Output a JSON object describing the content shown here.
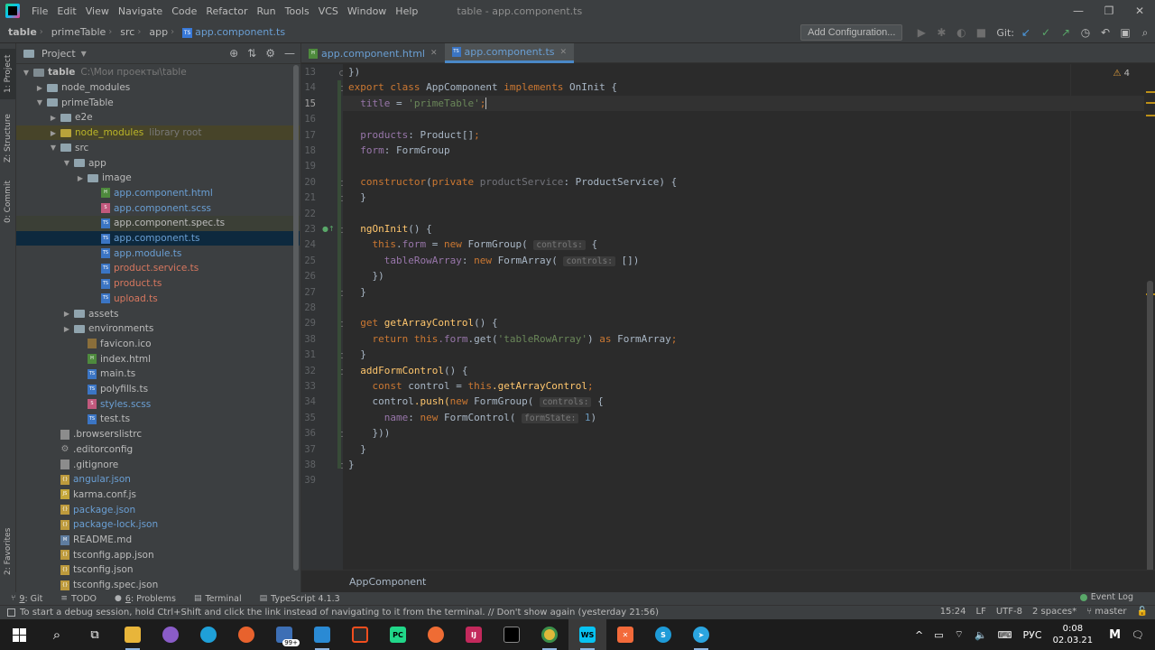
{
  "menubar": {
    "items": [
      "File",
      "Edit",
      "View",
      "Navigate",
      "Code",
      "Refactor",
      "Run",
      "Tools",
      "VCS",
      "Window",
      "Help"
    ],
    "window_title": "table - app.component.ts"
  },
  "navbar": {
    "crumbs": [
      "table",
      "primeTable",
      "src",
      "app",
      "app.component.ts"
    ],
    "add_config": "Add Configuration...",
    "git_label": "Git:"
  },
  "left_strip": {
    "project_tab": "1: Project",
    "structure_tab": "Z: Structure",
    "commit_tab": "0: Commit",
    "favorites_tab": "2: Favorites"
  },
  "project": {
    "header": "Project",
    "tree": [
      {
        "name": "table",
        "extra": "C:\\Мои проекты\\table",
        "depth": 0,
        "arrow": "down",
        "icon": "folder-dark",
        "style": "bold"
      },
      {
        "name": "node_modules",
        "depth": 1,
        "arrow": "right",
        "icon": "folder"
      },
      {
        "name": "primeTable",
        "depth": 1,
        "arrow": "down",
        "icon": "folder"
      },
      {
        "name": "e2e",
        "depth": 2,
        "arrow": "right",
        "icon": "folder"
      },
      {
        "name": "node_modules",
        "extra": "library root",
        "depth": 2,
        "arrow": "right",
        "icon": "folder-yellow",
        "style": "yellow",
        "row": "lib"
      },
      {
        "name": "src",
        "depth": 2,
        "arrow": "down",
        "icon": "folder"
      },
      {
        "name": "app",
        "depth": 3,
        "arrow": "down",
        "icon": "folder"
      },
      {
        "name": "image",
        "depth": 4,
        "arrow": "right",
        "icon": "folder"
      },
      {
        "name": "app.component.html",
        "depth": 5,
        "icon": "html",
        "style": "blue"
      },
      {
        "name": "app.component.scss",
        "depth": 5,
        "icon": "scss",
        "style": "blue"
      },
      {
        "name": "app.component.spec.ts",
        "depth": 5,
        "icon": "ts",
        "style": "white",
        "row": "hl"
      },
      {
        "name": "app.component.ts",
        "depth": 5,
        "icon": "ts",
        "style": "blue",
        "row": "sel"
      },
      {
        "name": "app.module.ts",
        "depth": 5,
        "icon": "ts",
        "style": "blue"
      },
      {
        "name": "product.service.ts",
        "depth": 5,
        "icon": "ts",
        "style": "red"
      },
      {
        "name": "product.ts",
        "depth": 5,
        "icon": "ts",
        "style": "red"
      },
      {
        "name": "upload.ts",
        "depth": 5,
        "icon": "ts",
        "style": "red"
      },
      {
        "name": "assets",
        "depth": 3,
        "arrow": "right",
        "icon": "folder"
      },
      {
        "name": "environments",
        "depth": 3,
        "arrow": "right",
        "icon": "folder"
      },
      {
        "name": "favicon.ico",
        "depth": 4,
        "icon": "ico",
        "style": "white"
      },
      {
        "name": "index.html",
        "depth": 4,
        "icon": "html",
        "style": "white"
      },
      {
        "name": "main.ts",
        "depth": 4,
        "icon": "ts",
        "style": "white"
      },
      {
        "name": "polyfills.ts",
        "depth": 4,
        "icon": "ts",
        "style": "white"
      },
      {
        "name": "styles.scss",
        "depth": 4,
        "icon": "scss",
        "style": "blue"
      },
      {
        "name": "test.ts",
        "depth": 4,
        "icon": "ts",
        "style": "white"
      },
      {
        "name": ".browserslistrc",
        "depth": 2,
        "icon": "txt",
        "style": "white"
      },
      {
        "name": ".editorconfig",
        "depth": 2,
        "icon": "gear",
        "style": "white"
      },
      {
        "name": ".gitignore",
        "depth": 2,
        "icon": "txt",
        "style": "white"
      },
      {
        "name": "angular.json",
        "depth": 2,
        "icon": "json",
        "style": "blue"
      },
      {
        "name": "karma.conf.js",
        "depth": 2,
        "icon": "js",
        "style": "white"
      },
      {
        "name": "package.json",
        "depth": 2,
        "icon": "json",
        "style": "blue"
      },
      {
        "name": "package-lock.json",
        "depth": 2,
        "icon": "json",
        "style": "blue"
      },
      {
        "name": "README.md",
        "depth": 2,
        "icon": "md",
        "style": "white"
      },
      {
        "name": "tsconfig.app.json",
        "depth": 2,
        "icon": "json",
        "style": "white"
      },
      {
        "name": "tsconfig.json",
        "depth": 2,
        "icon": "json",
        "style": "white"
      },
      {
        "name": "tsconfig.spec.json",
        "depth": 2,
        "icon": "json",
        "style": "white"
      }
    ]
  },
  "tabs": [
    {
      "label": "app.component.html",
      "icon": "html",
      "active": false
    },
    {
      "label": "app.component.ts",
      "icon": "ts",
      "active": true
    }
  ],
  "editor": {
    "line_numbers": [
      "13",
      "14",
      "15",
      "16",
      "17",
      "18",
      "19",
      "20",
      "21",
      "22",
      "23",
      "24",
      "25",
      "26",
      "27",
      "28",
      "29",
      "38",
      "31",
      "32",
      "33",
      "34",
      "35",
      "36",
      "37",
      "38",
      "39"
    ],
    "current_line": "15",
    "warnings": "4",
    "hints": {
      "controls": "controls:",
      "state": "formState:"
    },
    "code": {
      "l13": "})",
      "l14_export": "export class",
      "l14_name": " AppComponent ",
      "l14_impl": "implements",
      "l14_iface": " OnInit {",
      "l15_field": "title",
      "l15_eq": " = ",
      "l15_str": "'primeTable'",
      "l15_semi": ";",
      "l17_field": "products",
      "l17_type": ": Product[]",
      "l17_semi": ";",
      "l18_field": "form",
      "l18_type": ": FormGroup",
      "l20_kw": "constructor",
      "l20_open": "(",
      "l20_priv": "private",
      "l20_param": " productService",
      "l20_rest": ": ProductService) {",
      "close_brace": "}",
      "l23_fn": "ngOnInit",
      "l23_rest": "() {",
      "l24_this": "this",
      "l24_dot": ".",
      "l24_form": "form",
      "l24_eq": " = ",
      "l24_new": "new",
      "l24_cls": " FormGroup(",
      "l24_brace": " {",
      "l25_field": "tableRowArray",
      "l25_colon": ": ",
      "l25_new": "new",
      "l25_cls": " FormArray(",
      "l25_rest": " [])",
      "l26": "})",
      "l29_kw": "get",
      "l29_fn": " getArrayControl",
      "l29_rest": "() {",
      "l30_ret": "return",
      "l30_this": " this",
      "l30_form": ".form",
      "l30_get": ".get(",
      "l30_str": "'tableRowArray'",
      "l30_close": ") ",
      "l30_as": "as",
      "l30_type": " FormArray",
      "l30_semi": ";",
      "l32_fn": "addFormControl",
      "l32_rest": "() {",
      "l33_const": "const",
      "l33_var": " control = ",
      "l33_this": "this",
      "l33_prop": ".getArrayControl",
      "l33_semi": ";",
      "l34_ctrl": "control",
      "l34_push": ".push(",
      "l34_new": "new",
      "l34_cls": " FormGroup(",
      "l34_brace": " {",
      "l35_field": "name",
      "l35_colon": ": ",
      "l35_new": "new",
      "l35_cls": " FormControl(",
      "l35_num": " 1",
      "l35_close": ")",
      "l36": "}))"
    }
  },
  "breadcrumb": "AppComponent",
  "tool_tabs": [
    {
      "icon": "⑂",
      "prefix": "9",
      "label": ": Git"
    },
    {
      "icon": "≡",
      "prefix": "",
      "label": "TODO"
    },
    {
      "icon": "●",
      "prefix": "6",
      "label": ": Problems"
    },
    {
      "icon": "▤",
      "prefix": "",
      "label": "Terminal"
    },
    {
      "icon": "▤",
      "prefix": "",
      "label": "TypeScript 4.1.3"
    }
  ],
  "event_log": "Event Log",
  "status": {
    "message": "To start a debug session, hold Ctrl+Shift and click the link instead of navigating to it from the terminal. // Don't show again (yesterday 21:56)",
    "position": "15:24",
    "line_sep": "LF",
    "encoding": "UTF-8",
    "indent": "2 spaces*",
    "branch": "master"
  },
  "taskbar": {
    "badge": "99+",
    "lang": "РУС",
    "time": "0:08",
    "date": "02.03.21"
  },
  "colors": {
    "accent": "#4a88c7",
    "keyword": "#cc7832",
    "string": "#6a8759",
    "field": "#9876aa",
    "function": "#ffc66d"
  }
}
